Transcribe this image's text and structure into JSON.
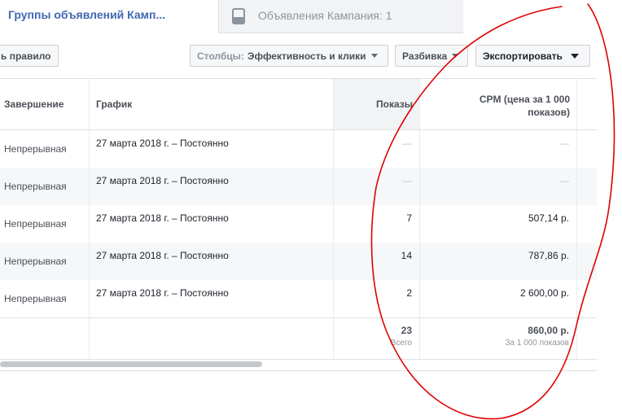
{
  "tabs": {
    "campaign_tab": "Группы объявлений Камп...",
    "ads_tab": "Объявления Кампания: 1"
  },
  "toolbar": {
    "rule_label": "ь правило",
    "columns_prefix": "Столбцы:",
    "columns_value": "Эффективность и клики",
    "breakdown_label": "Разбивка",
    "export_label": "Экспортировать"
  },
  "table": {
    "headers": {
      "end": "Завершение",
      "schedule": "График",
      "impressions": "Показы",
      "cpm_line1": "CPM (цена за 1 000",
      "cpm_line2": "показов)"
    },
    "rows": [
      {
        "end": "Непрерывная",
        "schedule": "27 марта 2018 г. – Постоянно",
        "impressions": "—",
        "cpm": "—"
      },
      {
        "end": "Непрерывная",
        "schedule": "27 марта 2018 г. – Постоянно",
        "impressions": "—",
        "cpm": "—"
      },
      {
        "end": "Непрерывная",
        "schedule": "27 марта 2018 г. – Постоянно",
        "impressions": "7",
        "cpm": "507,14 р."
      },
      {
        "end": "Непрерывная",
        "schedule": "27 марта 2018 г. – Постоянно",
        "impressions": "14",
        "cpm": "787,86 р."
      },
      {
        "end": "Непрерывная",
        "schedule": "27 марта 2018 г. – Постоянно",
        "impressions": "2",
        "cpm": "2 600,00 р."
      }
    ],
    "totals": {
      "impressions": "23",
      "impressions_sub": "Всего",
      "cpm": "860,00 р.",
      "cpm_sub": "За 1 000 показов"
    }
  },
  "colors": {
    "link_blue": "#4267b2",
    "annotation_red": "#e00000",
    "sorted_column_bg": "#f2f3f5"
  },
  "icons": [
    "document-icon",
    "caret-down-icon"
  ]
}
